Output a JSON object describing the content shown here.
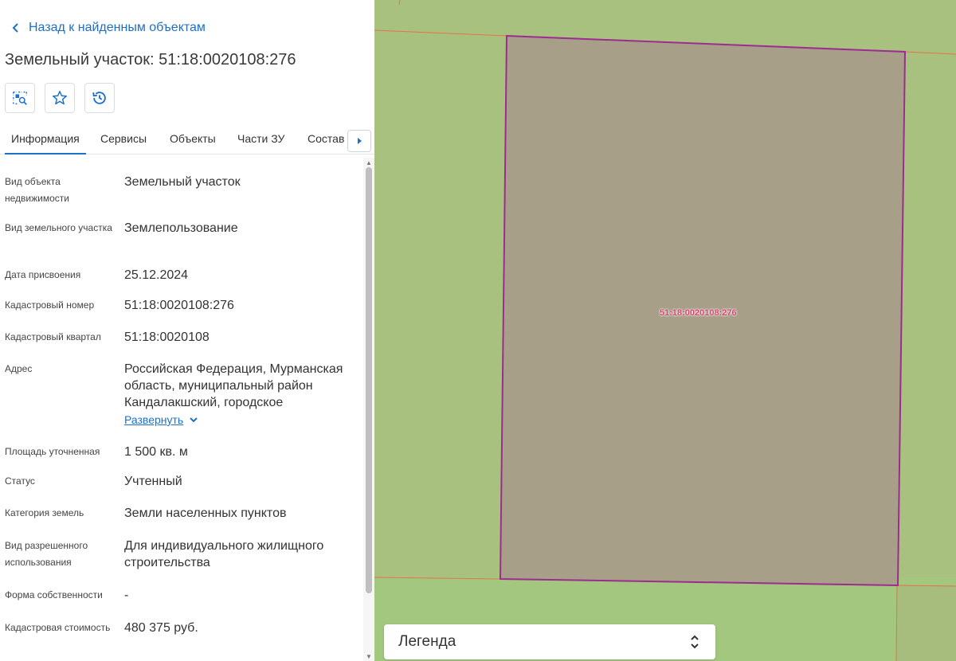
{
  "panel": {
    "back_link": "Назад к найденным объектам",
    "title": "Земельный участок: 51:18:0020108:276",
    "toolbar": {
      "locate_icon": "locate-on-map-icon",
      "favorite_icon": "star-icon",
      "history_icon": "history-icon"
    },
    "tabs": [
      "Информация",
      "Сервисы",
      "Объекты",
      "Части ЗУ",
      "Состав"
    ],
    "active_tab": "Информация",
    "properties": [
      {
        "label": "Вид объекта недвижимости",
        "value": "Земельный участок"
      },
      {
        "label": "Вид земельного участка",
        "value": "Землепользование"
      },
      {
        "label": "Дата присвоения",
        "value": "25.12.2024"
      },
      {
        "label": "Кадастровый номер",
        "value": "51:18:0020108:276"
      },
      {
        "label": "Кадастровый квартал",
        "value": "51:18:0020108"
      },
      {
        "label": "Адрес",
        "value": "Российская Федерация, Мурманская область, муниципальный район Кандалакшский, городское",
        "expand_label": "Развернуть"
      },
      {
        "label": "Площадь уточненная",
        "value": "1 500 кв. м"
      },
      {
        "label": "Статус",
        "value": "Учтенный"
      },
      {
        "label": "Категория земель",
        "value": "Земли населенных пунктов"
      },
      {
        "label": "Вид разрешенного использования",
        "value": "Для индивидуального жилищного строительства"
      },
      {
        "label": "Форма собственности",
        "value": "-"
      },
      {
        "label": "Кадастровая стоимость",
        "value": "480 375 руб."
      }
    ]
  },
  "map": {
    "parcel_label": "51:18:0020108:276",
    "colors": {
      "background": "#a8c17f",
      "parcel_fill": "#a89f89",
      "parcel_border": "#9c2c8f",
      "boundary_lines": "#e4734a"
    },
    "legend_label": "Легенда"
  }
}
